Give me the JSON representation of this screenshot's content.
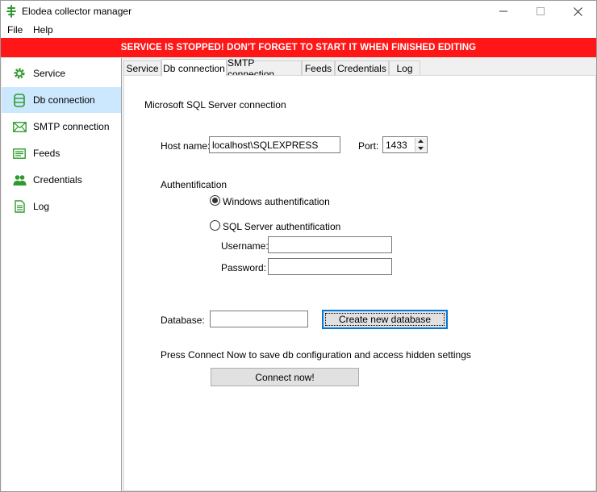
{
  "window": {
    "title": "Elodea collector manager"
  },
  "menu": {
    "file": "File",
    "help": "Help"
  },
  "banner": {
    "text": "SERVICE IS STOPPED! DON'T FORGET TO START IT WHEN FINISHED EDITING",
    "color": "#ff1616"
  },
  "sidebar": {
    "items": [
      {
        "label": "Service",
        "icon": "gear-icon"
      },
      {
        "label": "Db connection",
        "icon": "database-icon"
      },
      {
        "label": "SMTP connection",
        "icon": "envelope-icon"
      },
      {
        "label": "Feeds",
        "icon": "feed-icon"
      },
      {
        "label": "Credentials",
        "icon": "people-icon"
      },
      {
        "label": "Log",
        "icon": "document-icon"
      }
    ],
    "selected": "Db connection",
    "icon_color": "#2e9a2e"
  },
  "tabs": {
    "items": [
      "Service",
      "Db connection",
      "SMTP connection",
      "Feeds",
      "Credentials",
      "Log"
    ],
    "active": "Db connection"
  },
  "db": {
    "section_title": "Microsoft SQL Server connection",
    "host_label": "Host name:",
    "host_value": "localhost\\SQLEXPRESS",
    "port_label": "Port:",
    "port_value": "1433",
    "auth_title": "Authentification",
    "auth_windows": "Windows authentification",
    "auth_sql": "SQL Server authentification",
    "auth_selected": "Windows authentification",
    "username_label": "Username:",
    "username_value": "",
    "password_label": "Password:",
    "password_value": "",
    "database_label": "Database:",
    "database_value": "",
    "create_button": "Create new database",
    "hint": "Press Connect Now to save db configuration and access hidden settings",
    "connect_button": "Connect now!"
  }
}
